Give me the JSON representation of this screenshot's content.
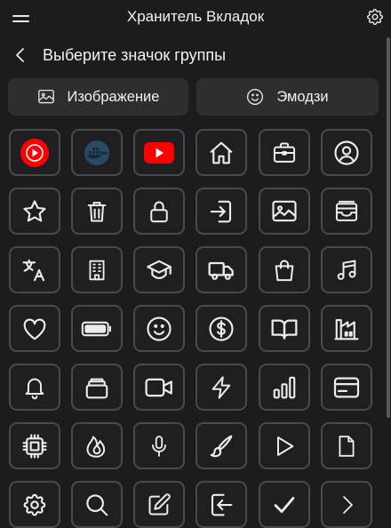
{
  "app": {
    "title": "Хранитель Вкладок"
  },
  "header": {
    "heading": "Выберите значок группы"
  },
  "type_buttons": {
    "image_label": "Изображение",
    "emoji_label": "Эмодзи"
  },
  "colors": {
    "background": "#1c1c1e",
    "tile_border": "#4a4a4c",
    "button_bg": "#2e2e30",
    "brand_red": "#ff0000"
  },
  "icons": [
    [
      "youtube-music",
      "docker",
      "youtube",
      "home",
      "briefcase",
      "user-circle"
    ],
    [
      "star",
      "trash",
      "lock",
      "login",
      "image",
      "inbox"
    ],
    [
      "translate",
      "building",
      "graduation-cap",
      "truck",
      "shopping-bag",
      "music-note"
    ],
    [
      "heart",
      "battery",
      "smiley",
      "dollar",
      "book",
      "factory"
    ],
    [
      "bell",
      "stack",
      "video-camera",
      "lightning",
      "bar-chart",
      "credit-card"
    ],
    [
      "cpu-chip",
      "fire",
      "microphone",
      "paintbrush",
      "play",
      "document"
    ],
    [
      "gear",
      "search",
      "edit",
      "logout",
      "check",
      "chevron-right"
    ]
  ]
}
